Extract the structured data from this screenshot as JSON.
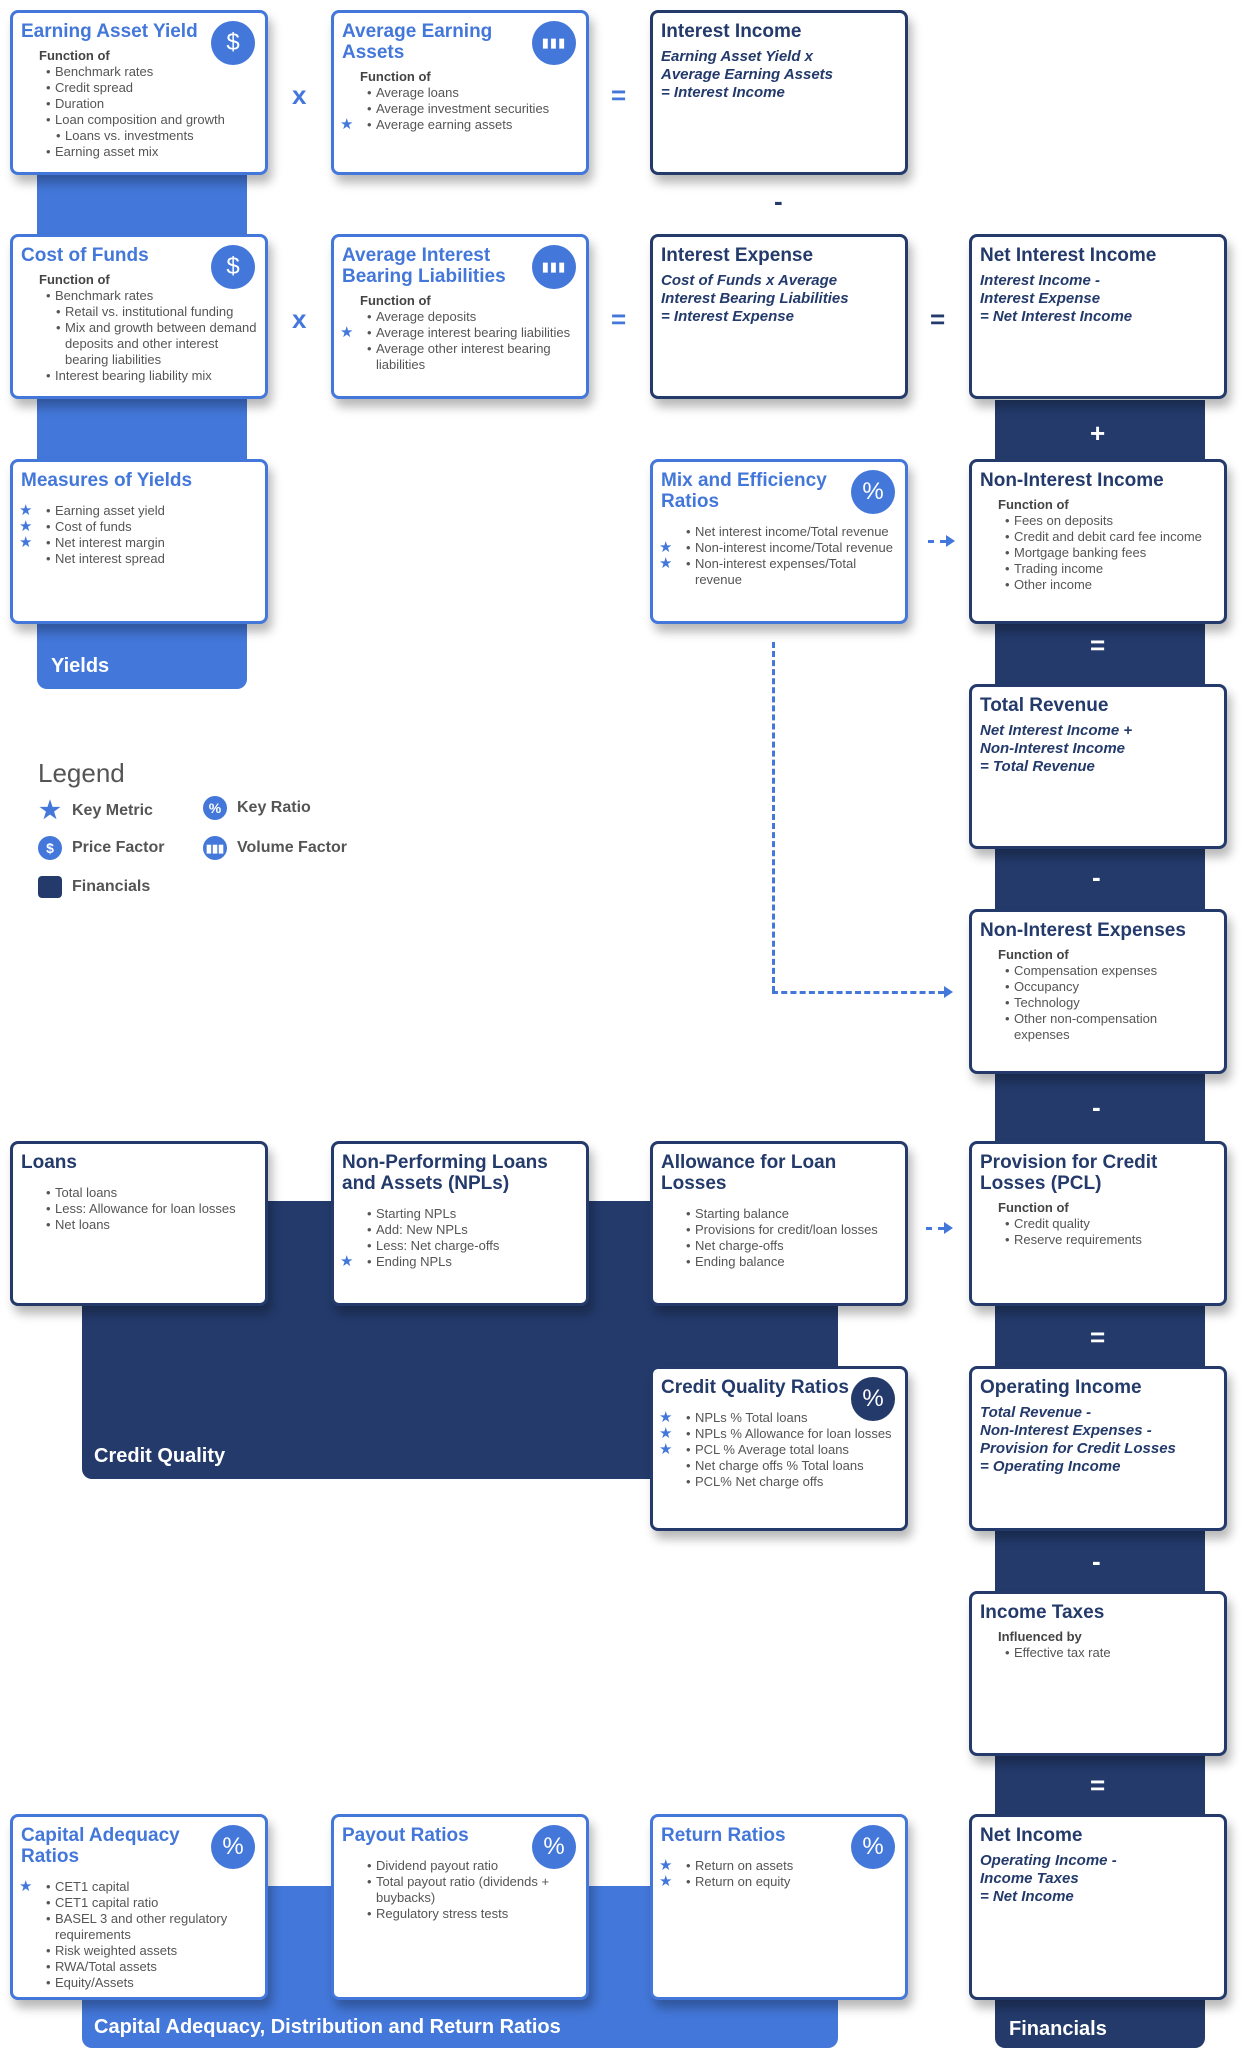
{
  "colors": {
    "light_blue": "#4377d9",
    "navy": "#233a6b"
  },
  "bands": {
    "yields": "Yields",
    "financials": "Financials",
    "credit_quality": "Credit Quality",
    "capital": "Capital Adequacy, Distribution and Return Ratios"
  },
  "operators": [
    "x",
    "=",
    "-",
    "x",
    "=",
    "=",
    "+",
    "=",
    "-",
    "-",
    "=",
    "-",
    "="
  ],
  "legend": {
    "title": "Legend",
    "key_metric": "Key Metric",
    "key_ratio": "Key Ratio",
    "price_factor": "Price Factor",
    "volume_factor": "Volume Factor",
    "financials": "Financials"
  },
  "cards": [
    {
      "title": "Earning Asset Yield",
      "style": "light",
      "icon": "dollar-icon",
      "sub": "Function of",
      "items": [
        {
          "t": "Benchmark rates"
        },
        {
          "t": "Credit spread"
        },
        {
          "t": "Duration"
        },
        {
          "t": "Loan composition and growth"
        },
        {
          "t": "Loans vs. investments",
          "indent": true
        },
        {
          "t": "Earning asset mix"
        }
      ]
    },
    {
      "title": "Average Earning Assets",
      "style": "light",
      "icon": "bar-chart-icon",
      "sub": "Function of",
      "items": [
        {
          "t": "Average loans"
        },
        {
          "t": "Average investment securities"
        },
        {
          "t": "Average earning assets",
          "star": true
        }
      ]
    },
    {
      "title": "Interest Income",
      "style": "dark",
      "formula": [
        "Earning Asset Yield x",
        "Average Earning Assets",
        "= Interest Income"
      ]
    },
    {
      "title": "Cost of Funds",
      "style": "light",
      "icon": "dollar-icon",
      "sub": "Function of",
      "items": [
        {
          "t": "Benchmark rates"
        },
        {
          "t": "Retail vs. institutional funding",
          "indent": true
        },
        {
          "t": "Mix and growth between demand deposits and other interest bearing liabilities",
          "indent": true
        },
        {
          "t": "Interest bearing liability mix"
        }
      ]
    },
    {
      "title": "Average Interest Bearing Liabilities",
      "style": "light",
      "icon": "bar-chart-icon",
      "sub": "Function of",
      "items": [
        {
          "t": "Average deposits"
        },
        {
          "t": "Average interest bearing liabilities",
          "star": true
        },
        {
          "t": "Average other interest bearing liabilities"
        }
      ]
    },
    {
      "title": "Interest Expense",
      "style": "dark",
      "formula": [
        "Cost of Funds x Average",
        "Interest Bearing Liabilities",
        "= Interest Expense"
      ]
    },
    {
      "title": "Net Interest Income",
      "style": "dark",
      "formula": [
        "Interest Income -",
        "Interest Expense",
        "= Net Interest Income"
      ]
    },
    {
      "title": "Measures of Yields",
      "style": "light",
      "wide": true,
      "items": [
        {
          "t": "Earning asset yield",
          "star": true
        },
        {
          "t": "Cost of funds",
          "star": true
        },
        {
          "t": "Net interest margin",
          "star": true
        },
        {
          "t": "Net interest spread"
        }
      ]
    },
    {
      "title": "Mix and Efficiency Ratios",
      "style": "light",
      "icon": "percent-icon",
      "items": [
        {
          "t": "Net interest income/Total revenue"
        },
        {
          "t": "Non-interest income/Total revenue",
          "star": true
        },
        {
          "t": "Non-interest expenses/Total revenue",
          "star": true
        }
      ]
    },
    {
      "title": "Non-Interest Income",
      "style": "dark",
      "sub": "Function of",
      "items": [
        {
          "t": "Fees on deposits"
        },
        {
          "t": "Credit and debit card fee income"
        },
        {
          "t": "Mortgage banking fees"
        },
        {
          "t": "Trading income"
        },
        {
          "t": "Other income"
        }
      ]
    },
    {
      "title": "Total Revenue",
      "style": "dark",
      "formula": [
        "Net Interest Income +",
        "Non-Interest Income",
        "= Total Revenue"
      ]
    },
    {
      "title": "Non-Interest Expenses",
      "style": "dark",
      "sub": "Function of",
      "items": [
        {
          "t": "Compensation expenses"
        },
        {
          "t": "Occupancy"
        },
        {
          "t": "Technology"
        },
        {
          "t": "Other non-compensation expenses"
        }
      ]
    },
    {
      "title": "Loans",
      "style": "dark",
      "items": [
        {
          "t": "Total loans"
        },
        {
          "t": "Less: Allowance for loan losses"
        },
        {
          "t": "Net loans"
        }
      ]
    },
    {
      "title": "Non-Performing Loans and Assets (NPLs)",
      "style": "dark",
      "items": [
        {
          "t": "Starting NPLs"
        },
        {
          "t": "Add: New NPLs"
        },
        {
          "t": "Less: Net charge-offs"
        },
        {
          "t": "Ending NPLs",
          "star": true
        }
      ]
    },
    {
      "title": "Allowance for Loan Losses",
      "style": "dark",
      "items": [
        {
          "t": "Starting balance"
        },
        {
          "t": "Provisions for credit/loan losses"
        },
        {
          "t": "Net charge-offs"
        },
        {
          "t": "Ending balance"
        }
      ]
    },
    {
      "title": "Provision for Credit Losses (PCL)",
      "style": "dark",
      "sub": "Function of",
      "items": [
        {
          "t": "Credit quality"
        },
        {
          "t": "Reserve requirements"
        }
      ]
    },
    {
      "title": "Credit Quality Ratios",
      "style": "dark",
      "icon": "percent-icon",
      "items": [
        {
          "t": "NPLs % Total loans",
          "star": true
        },
        {
          "t": "NPLs % Allowance for loan losses",
          "star": true
        },
        {
          "t": "PCL % Average total loans",
          "star": true
        },
        {
          "t": "Net charge offs % Total loans"
        },
        {
          "t": "PCL% Net charge offs"
        }
      ]
    },
    {
      "title": "Operating Income",
      "style": "dark",
      "formula": [
        "Total Revenue -",
        "Non-Interest Expenses -",
        "Provision for Credit Losses",
        "= Operating Income"
      ]
    },
    {
      "title": "Income Taxes",
      "style": "dark",
      "sub": "Influenced by",
      "items": [
        {
          "t": "Effective tax rate"
        }
      ]
    },
    {
      "title": "Capital Adequacy Ratios",
      "style": "light",
      "icon": "percent-icon",
      "items": [
        {
          "t": "CET1 capital",
          "star": true
        },
        {
          "t": "CET1 capital ratio"
        },
        {
          "t": "BASEL 3 and other regulatory requirements"
        },
        {
          "t": "Risk weighted assets"
        },
        {
          "t": "RWA/Total assets"
        },
        {
          "t": "Equity/Assets"
        }
      ]
    },
    {
      "title": "Payout Ratios",
      "style": "light",
      "icon": "percent-icon",
      "items": [
        {
          "t": "Dividend payout ratio"
        },
        {
          "t": "Total payout ratio (dividends + buybacks)"
        },
        {
          "t": "Regulatory stress tests"
        }
      ]
    },
    {
      "title": "Return Ratios",
      "style": "light",
      "icon": "percent-icon",
      "items": [
        {
          "t": "Return on assets",
          "star": true
        },
        {
          "t": "Return on equity",
          "star": true
        }
      ]
    },
    {
      "title": "Net Income",
      "style": "dark",
      "formula": [
        "Operating Income -",
        "Income Taxes",
        "= Net Income"
      ]
    }
  ]
}
